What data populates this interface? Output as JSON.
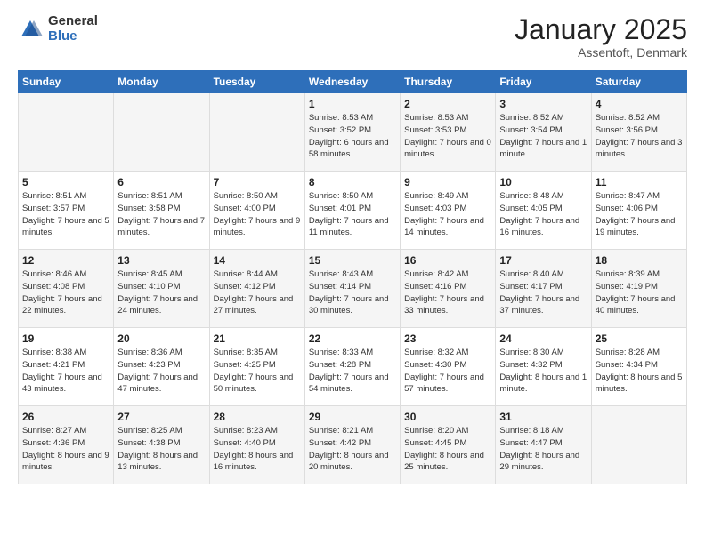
{
  "header": {
    "logo_general": "General",
    "logo_blue": "Blue",
    "title": "January 2025",
    "location": "Assentoft, Denmark"
  },
  "days_of_week": [
    "Sunday",
    "Monday",
    "Tuesday",
    "Wednesday",
    "Thursday",
    "Friday",
    "Saturday"
  ],
  "weeks": [
    [
      {
        "num": "",
        "sunrise": "",
        "sunset": "",
        "daylight": ""
      },
      {
        "num": "",
        "sunrise": "",
        "sunset": "",
        "daylight": ""
      },
      {
        "num": "",
        "sunrise": "",
        "sunset": "",
        "daylight": ""
      },
      {
        "num": "1",
        "sunrise": "Sunrise: 8:53 AM",
        "sunset": "Sunset: 3:52 PM",
        "daylight": "Daylight: 6 hours and 58 minutes."
      },
      {
        "num": "2",
        "sunrise": "Sunrise: 8:53 AM",
        "sunset": "Sunset: 3:53 PM",
        "daylight": "Daylight: 7 hours and 0 minutes."
      },
      {
        "num": "3",
        "sunrise": "Sunrise: 8:52 AM",
        "sunset": "Sunset: 3:54 PM",
        "daylight": "Daylight: 7 hours and 1 minute."
      },
      {
        "num": "4",
        "sunrise": "Sunrise: 8:52 AM",
        "sunset": "Sunset: 3:56 PM",
        "daylight": "Daylight: 7 hours and 3 minutes."
      }
    ],
    [
      {
        "num": "5",
        "sunrise": "Sunrise: 8:51 AM",
        "sunset": "Sunset: 3:57 PM",
        "daylight": "Daylight: 7 hours and 5 minutes."
      },
      {
        "num": "6",
        "sunrise": "Sunrise: 8:51 AM",
        "sunset": "Sunset: 3:58 PM",
        "daylight": "Daylight: 7 hours and 7 minutes."
      },
      {
        "num": "7",
        "sunrise": "Sunrise: 8:50 AM",
        "sunset": "Sunset: 4:00 PM",
        "daylight": "Daylight: 7 hours and 9 minutes."
      },
      {
        "num": "8",
        "sunrise": "Sunrise: 8:50 AM",
        "sunset": "Sunset: 4:01 PM",
        "daylight": "Daylight: 7 hours and 11 minutes."
      },
      {
        "num": "9",
        "sunrise": "Sunrise: 8:49 AM",
        "sunset": "Sunset: 4:03 PM",
        "daylight": "Daylight: 7 hours and 14 minutes."
      },
      {
        "num": "10",
        "sunrise": "Sunrise: 8:48 AM",
        "sunset": "Sunset: 4:05 PM",
        "daylight": "Daylight: 7 hours and 16 minutes."
      },
      {
        "num": "11",
        "sunrise": "Sunrise: 8:47 AM",
        "sunset": "Sunset: 4:06 PM",
        "daylight": "Daylight: 7 hours and 19 minutes."
      }
    ],
    [
      {
        "num": "12",
        "sunrise": "Sunrise: 8:46 AM",
        "sunset": "Sunset: 4:08 PM",
        "daylight": "Daylight: 7 hours and 22 minutes."
      },
      {
        "num": "13",
        "sunrise": "Sunrise: 8:45 AM",
        "sunset": "Sunset: 4:10 PM",
        "daylight": "Daylight: 7 hours and 24 minutes."
      },
      {
        "num": "14",
        "sunrise": "Sunrise: 8:44 AM",
        "sunset": "Sunset: 4:12 PM",
        "daylight": "Daylight: 7 hours and 27 minutes."
      },
      {
        "num": "15",
        "sunrise": "Sunrise: 8:43 AM",
        "sunset": "Sunset: 4:14 PM",
        "daylight": "Daylight: 7 hours and 30 minutes."
      },
      {
        "num": "16",
        "sunrise": "Sunrise: 8:42 AM",
        "sunset": "Sunset: 4:16 PM",
        "daylight": "Daylight: 7 hours and 33 minutes."
      },
      {
        "num": "17",
        "sunrise": "Sunrise: 8:40 AM",
        "sunset": "Sunset: 4:17 PM",
        "daylight": "Daylight: 7 hours and 37 minutes."
      },
      {
        "num": "18",
        "sunrise": "Sunrise: 8:39 AM",
        "sunset": "Sunset: 4:19 PM",
        "daylight": "Daylight: 7 hours and 40 minutes."
      }
    ],
    [
      {
        "num": "19",
        "sunrise": "Sunrise: 8:38 AM",
        "sunset": "Sunset: 4:21 PM",
        "daylight": "Daylight: 7 hours and 43 minutes."
      },
      {
        "num": "20",
        "sunrise": "Sunrise: 8:36 AM",
        "sunset": "Sunset: 4:23 PM",
        "daylight": "Daylight: 7 hours and 47 minutes."
      },
      {
        "num": "21",
        "sunrise": "Sunrise: 8:35 AM",
        "sunset": "Sunset: 4:25 PM",
        "daylight": "Daylight: 7 hours and 50 minutes."
      },
      {
        "num": "22",
        "sunrise": "Sunrise: 8:33 AM",
        "sunset": "Sunset: 4:28 PM",
        "daylight": "Daylight: 7 hours and 54 minutes."
      },
      {
        "num": "23",
        "sunrise": "Sunrise: 8:32 AM",
        "sunset": "Sunset: 4:30 PM",
        "daylight": "Daylight: 7 hours and 57 minutes."
      },
      {
        "num": "24",
        "sunrise": "Sunrise: 8:30 AM",
        "sunset": "Sunset: 4:32 PM",
        "daylight": "Daylight: 8 hours and 1 minute."
      },
      {
        "num": "25",
        "sunrise": "Sunrise: 8:28 AM",
        "sunset": "Sunset: 4:34 PM",
        "daylight": "Daylight: 8 hours and 5 minutes."
      }
    ],
    [
      {
        "num": "26",
        "sunrise": "Sunrise: 8:27 AM",
        "sunset": "Sunset: 4:36 PM",
        "daylight": "Daylight: 8 hours and 9 minutes."
      },
      {
        "num": "27",
        "sunrise": "Sunrise: 8:25 AM",
        "sunset": "Sunset: 4:38 PM",
        "daylight": "Daylight: 8 hours and 13 minutes."
      },
      {
        "num": "28",
        "sunrise": "Sunrise: 8:23 AM",
        "sunset": "Sunset: 4:40 PM",
        "daylight": "Daylight: 8 hours and 16 minutes."
      },
      {
        "num": "29",
        "sunrise": "Sunrise: 8:21 AM",
        "sunset": "Sunset: 4:42 PM",
        "daylight": "Daylight: 8 hours and 20 minutes."
      },
      {
        "num": "30",
        "sunrise": "Sunrise: 8:20 AM",
        "sunset": "Sunset: 4:45 PM",
        "daylight": "Daylight: 8 hours and 25 minutes."
      },
      {
        "num": "31",
        "sunrise": "Sunrise: 8:18 AM",
        "sunset": "Sunset: 4:47 PM",
        "daylight": "Daylight: 8 hours and 29 minutes."
      },
      {
        "num": "",
        "sunrise": "",
        "sunset": "",
        "daylight": ""
      }
    ]
  ]
}
